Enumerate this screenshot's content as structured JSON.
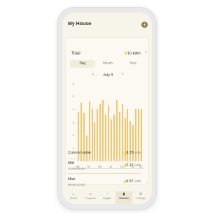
{
  "header": {
    "title": "My House",
    "chevron_icon": "chevron-down-icon",
    "add_icon": "+"
  },
  "total": {
    "label": "Total",
    "value": "10 kWh"
  },
  "tabs": [
    {
      "label": "Day",
      "active": true
    },
    {
      "label": "Month",
      "active": false
    },
    {
      "label": "Year",
      "active": false
    }
  ],
  "datenav": {
    "prev": "‹",
    "label": "July 9",
    "next": "›"
  },
  "chart_data": {
    "type": "bar",
    "categories": [
      "00",
      "01",
      "02",
      "03",
      "04",
      "05",
      "06",
      "07",
      "08",
      "09",
      "10",
      "11",
      "12",
      "13",
      "14",
      "15",
      "16",
      "17",
      "18",
      "19",
      "20",
      "21",
      "22",
      "23"
    ],
    "x_tick_labels": [
      "00",
      "04",
      "08",
      "12",
      "16",
      "20",
      "23"
    ],
    "values": [
      3.8,
      4.5,
      3.7,
      2.0,
      4.6,
      4.0,
      3.0,
      4.0,
      4.4,
      4.7,
      3.6,
      4.3,
      3.2,
      3.6,
      4.7,
      3.8,
      4.4,
      3.3,
      4.0,
      3.1,
      2.8,
      4.0,
      4.0,
      4.0
    ],
    "ylim": [
      0,
      6
    ],
    "y_ticks": [
      "6",
      "5",
      "4",
      "3",
      "2",
      "1",
      "0"
    ],
    "bar_color": "#f5c56d"
  },
  "stats": {
    "current": {
      "label": "Current value",
      "value": "3.78",
      "unit": "kWh"
    },
    "min": {
      "label": "Min",
      "time": "04:00-05:00",
      "value": "2.12",
      "unit": "kWh"
    },
    "max": {
      "label": "Max",
      "time": "09:00-10:00",
      "value": "4.57",
      "unit": "kWh"
    }
  },
  "nav": [
    {
      "label": "House",
      "icon": "⌂",
      "active": false
    },
    {
      "label": "Programs",
      "icon": "▭",
      "active": false
    },
    {
      "label": "Insights",
      "icon": "◔",
      "active": false
    },
    {
      "label": "Statistics",
      "icon": "▮",
      "active": true
    },
    {
      "label": "Settings",
      "icon": "⚙",
      "active": false
    }
  ],
  "colors": {
    "accent": "#f5c56d",
    "bolt": "#f0a43a",
    "screen_bg": "#f7f4ea"
  }
}
